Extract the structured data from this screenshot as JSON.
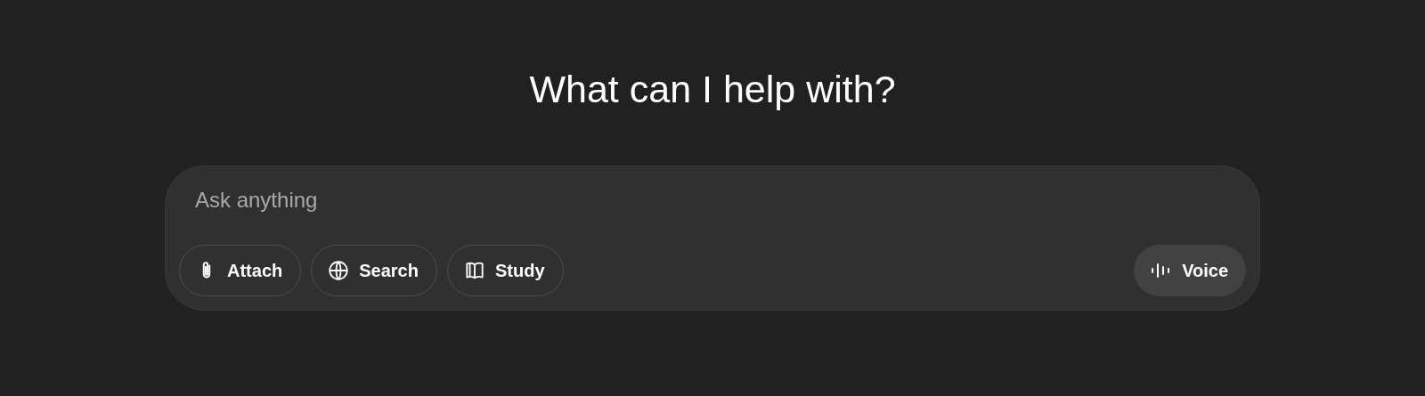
{
  "heading": "What can I help with?",
  "composer": {
    "placeholder": "Ask anything",
    "tools": [
      {
        "kind": "attach",
        "label": "Attach"
      },
      {
        "kind": "search",
        "label": "Search"
      },
      {
        "kind": "study",
        "label": "Study"
      }
    ],
    "voice": {
      "label": "Voice"
    }
  }
}
